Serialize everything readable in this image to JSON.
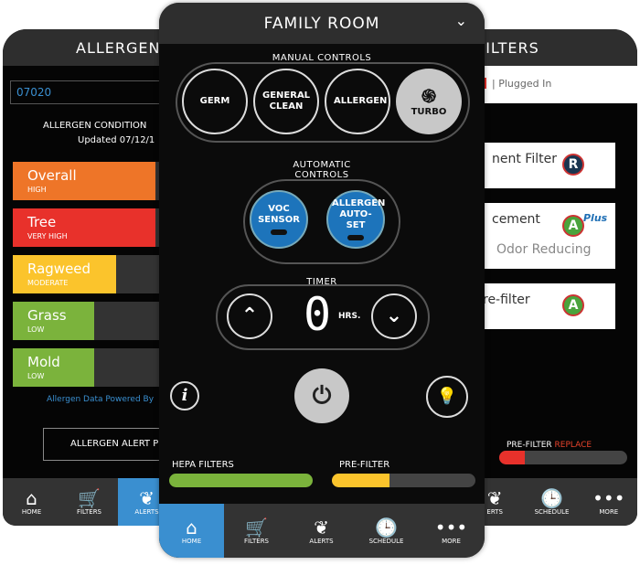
{
  "left": {
    "title": "ALLERGEN",
    "zip": "07020",
    "conditions_title": "ALLERGEN CONDITION",
    "updated": "Updated 07/12/1",
    "allergens": [
      {
        "name": "Overall",
        "level": "HIGH",
        "color": "#ee7528",
        "pct": 100
      },
      {
        "name": "Tree",
        "level": "VERY HIGH",
        "color": "#e8312b",
        "pct": 100
      },
      {
        "name": "Ragweed",
        "level": "MODERATE",
        "color": "#fbc42c",
        "pct": 65
      },
      {
        "name": "Grass",
        "level": "LOW",
        "color": "#7bb33c",
        "pct": 47
      },
      {
        "name": "Mold",
        "level": "LOW",
        "color": "#7bb33c",
        "pct": 47
      }
    ],
    "powered_by": "Allergen Data Powered By",
    "alert_button": "ALLERGEN ALERT P",
    "nav": [
      {
        "label": "HOME",
        "icon": "home-icon"
      },
      {
        "label": "FILTERS",
        "icon": "cart-icon"
      },
      {
        "label": "ALERTS",
        "icon": "leaf-icon",
        "active": true
      }
    ]
  },
  "center": {
    "title": "FAMILY ROOM",
    "manual_label": "MANUAL CONTROLS",
    "manual": [
      "GERM",
      "GENERAL CLEAN",
      "ALLERGEN",
      "TURBO"
    ],
    "auto_label": "AUTOMATIC CONTROLS",
    "auto": [
      "VOC SENSOR",
      "ALLERGEN AUTO-SET"
    ],
    "timer_label": "TIMER",
    "timer_value": "0",
    "timer_unit": "HRS.",
    "hepa_label": "HEPA FILTERS",
    "hepa_pct": 100,
    "prefilter_label": "PRE-FILTER",
    "prefilter_pct": 40,
    "nav": [
      {
        "label": "HOME",
        "icon": "home-icon",
        "active": true
      },
      {
        "label": "FILTERS",
        "icon": "cart-icon"
      },
      {
        "label": "ALERTS",
        "icon": "leaf-icon"
      },
      {
        "label": "SCHEDULE",
        "icon": "clock-icon"
      },
      {
        "label": "MORE",
        "icon": "more-icon"
      }
    ]
  },
  "right": {
    "title": "FILTERS",
    "status": "| Plugged In",
    "cards": [
      {
        "title": "nent Filter",
        "badge": "R"
      },
      {
        "title": "cement",
        "subtitle": "Odor Reducing",
        "badge": "A",
        "badge_extra": "Plus"
      },
      {
        "title": "re-filter",
        "badge": "A"
      }
    ],
    "prefilter_label": "PRE-FILTER",
    "prefilter_status": "REPLACE",
    "prefilter_pct": 20,
    "nav": [
      {
        "label": "ERTS",
        "icon": "leaf-icon"
      },
      {
        "label": "SCHEDULE",
        "icon": "clock-icon"
      },
      {
        "label": "MORE",
        "icon": "more-icon"
      }
    ]
  },
  "colors": {
    "accent": "#3a8fd0",
    "green": "#7bb33c",
    "yellow": "#fbc42c",
    "red": "#e8312b"
  }
}
